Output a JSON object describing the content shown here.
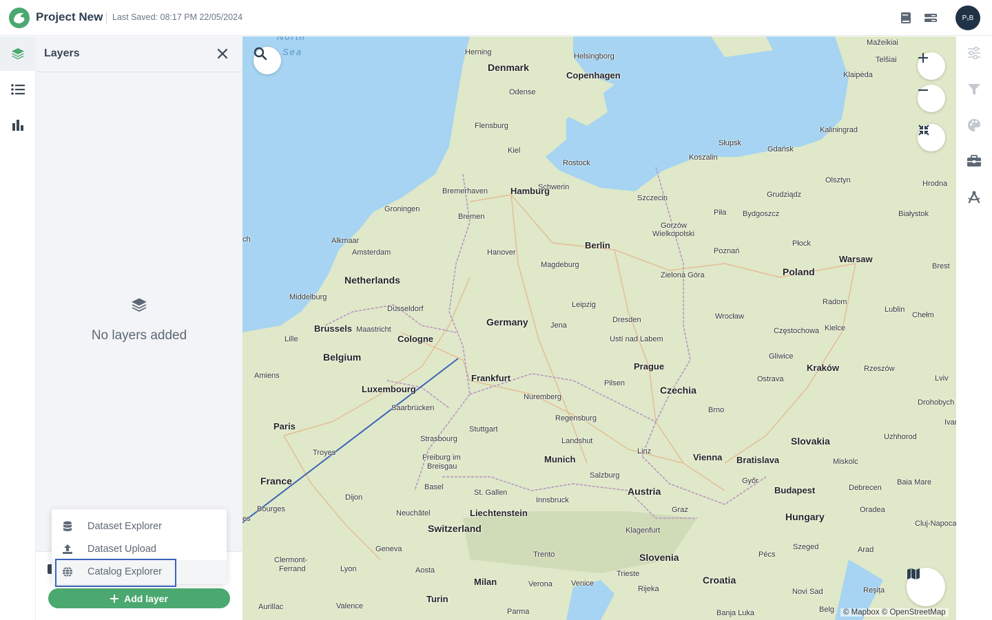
{
  "header": {
    "project_title": "Project New",
    "last_saved": "Last Saved: 08:17 PM 22/05/2024",
    "avatar_initials": "P₁B"
  },
  "left_rail": {
    "items": [
      {
        "name": "layers",
        "active": true
      },
      {
        "name": "legend"
      },
      {
        "name": "charts"
      }
    ]
  },
  "layers_panel": {
    "title": "Layers",
    "empty_text": "No layers added",
    "add_layer_label": "Add layer",
    "add_menu": [
      {
        "label": "Dataset Explorer",
        "icon": "database-icon"
      },
      {
        "label": "Dataset Upload",
        "icon": "upload-icon"
      },
      {
        "label": "Catalog Explorer",
        "icon": "globe-icon",
        "highlighted": true
      }
    ]
  },
  "map": {
    "attribution": "© Mapbox © OpenStreetMap",
    "labels": {
      "north_sea": "North",
      "north_sea2": "Sea",
      "denmark": "Denmark",
      "herning": "Herning",
      "helsingborg": "Helsingborg",
      "copenhagen": "Copenhagen",
      "odense": "Odense",
      "flensburg": "Flensburg",
      "kiel": "Kiel",
      "rostock": "Rostock",
      "mazeikiai": "Mažeikiai",
      "telsiai": "Telšiai",
      "klaipeda": "Klaipėda",
      "kaliningrad": "Kaliningrad",
      "slupsk": "Słupsk",
      "gdansk": "Gdańsk",
      "koszalin": "Koszalin",
      "olsztyn": "Olsztyn",
      "hrodna": "Hrodna",
      "bremerhaven": "Bremerhaven",
      "hamburg": "Hamburg",
      "schwerin": "Schwerin",
      "szczecin": "Szczecin",
      "grudziadz": "Grudziądz",
      "groningen": "Groningen",
      "bremen": "Bremen",
      "pila": "Piła",
      "bydgoszcz": "Bydgoszcz",
      "bialystok": "Białystok",
      "alkmaar": "Alkmaar",
      "amsterdam": "Amsterdam",
      "berlin": "Berlin",
      "gorzow": "Gorzów",
      "wielkopolski": "Wielkopolski",
      "plock": "Płock",
      "hanover": "Hanover",
      "magdeburg": "Magdeburg",
      "poznan": "Poznań",
      "warsaw": "Warsaw",
      "brest": "Brest",
      "netherlands": "Netherlands",
      "poland": "Poland",
      "zielona_gora": "Zielona Góra",
      "middelburg": "Middelburg",
      "leipzig": "Leipzig",
      "radom": "Radom",
      "lublin": "Lublin",
      "dusseldorf": "Düsseldorf",
      "dresden": "Dresden",
      "wroclaw": "Wrocław",
      "chelm": "Chełm",
      "germany": "Germany",
      "brussels": "Brussels",
      "maastricht": "Maastricht",
      "jena": "Jena",
      "usti": "Ustí nad Labem",
      "czestochowa": "Częstochowa",
      "kielce": "Kielce",
      "lille": "Lille",
      "cologne": "Cologne",
      "belgium": "Belgium",
      "gliwice": "Gliwice",
      "prague": "Prague",
      "krakow": "Kraków",
      "rzeszow": "Rzeszów",
      "amiens": "Amiens",
      "frankfurt": "Frankfurt",
      "pilsen": "Pilsen",
      "ostrava": "Ostrava",
      "lviv": "Lviv",
      "luxembourg": "Luxembourg",
      "czechia": "Czechia",
      "nuremberg": "Nuremberg",
      "drohobych": "Drohobych",
      "saarbrucken": "Saarbrücken",
      "brno": "Brno",
      "paris": "Paris",
      "regensburg": "Regensburg",
      "ivano": "Ivan",
      "strasbourg": "Strasbourg",
      "stuttgart": "Stuttgart",
      "slovakia": "Slovakia",
      "uzhhorod": "Uzhhorod",
      "landshut": "Landshut",
      "troyes": "Troyes",
      "freiburg": "Freiburg im",
      "breisgau": "Breisgau",
      "linz": "Linz",
      "munich": "Munich",
      "vienna": "Vienna",
      "bratislava": "Bratislava",
      "miskolc": "Miskolc",
      "france": "France",
      "salzburg": "Salzburg",
      "basel": "Basel",
      "gyor": "Győr",
      "austria": "Austria",
      "budapest": "Budapest",
      "debrecen": "Debrecen",
      "baia_mare": "Baia Mare",
      "dijon": "Dijon",
      "st_gallen": "St. Gallen",
      "innsbruck": "Innsbruck",
      "graz": "Graz",
      "bourges": "Bourges",
      "neuchatel": "Neuchâtel",
      "liechtenstein": "Liechtenstein",
      "oradea": "Oradea",
      "hungary": "Hungary",
      "cluj": "Cluj-Napoca",
      "switzerland": "Switzerland",
      "klagenfurt": "Klagenfurt",
      "szeged": "Szeged",
      "arad": "Arad",
      "geneva": "Geneva",
      "trento": "Trento",
      "slovenia": "Slovenia",
      "pecs": "Pécs",
      "clermont": "Clermont-",
      "ferrand": "Ferrand",
      "lyon": "Lyon",
      "aosta": "Aosta",
      "trieste": "Trieste",
      "croatia": "Croatia",
      "milan": "Milan",
      "verona": "Verona",
      "venice": "Venice",
      "rijeka": "Rijeka",
      "novi_sad": "Novi Sad",
      "resita": "Reșița",
      "turin": "Turin",
      "aurillac": "Aurillac",
      "valence": "Valence",
      "parma": "Parma",
      "banja_luka": "Banja Luka",
      "belgrade": "Belg",
      "sch": "ch",
      "es": "es"
    }
  },
  "colors": {
    "accent": "#4aa870",
    "water": "#a6d4f2",
    "land": "#dfe8c8",
    "highlight_box": "#3a63b8"
  }
}
